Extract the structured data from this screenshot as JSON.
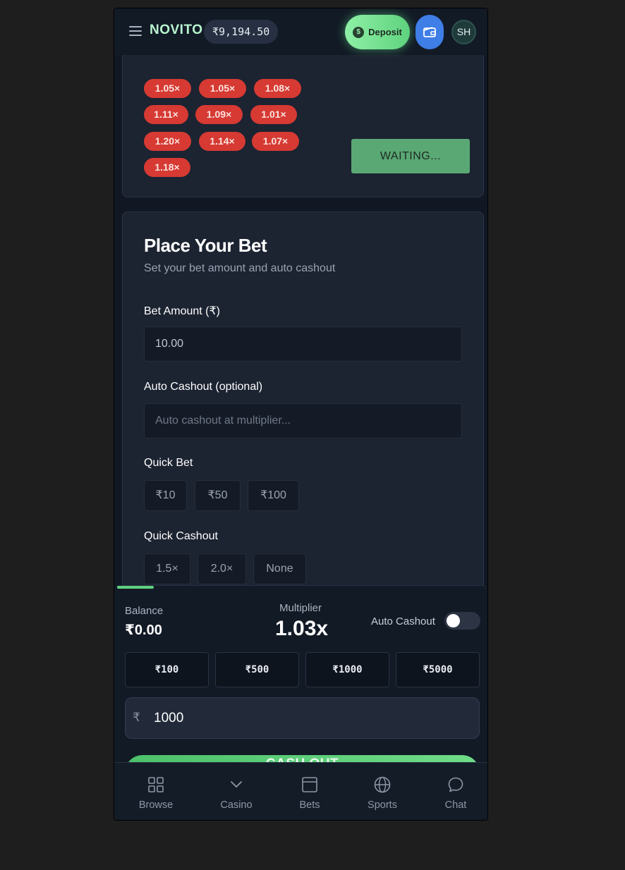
{
  "header": {
    "brand": "NOVITO",
    "balance": "₹9,194.50",
    "deposit_label": "Deposit",
    "deposit_icon": "$",
    "avatar_initials": "SH"
  },
  "history": {
    "multipliers": [
      "1.05×",
      "1.05×",
      "1.08×",
      "1.11×",
      "1.09×",
      "1.01×",
      "1.20×",
      "1.14×",
      "1.07×",
      "1.18×"
    ],
    "waiting_label": "WAITING..."
  },
  "bet_form": {
    "title": "Place Your Bet",
    "subtitle": "Set your bet amount and auto cashout",
    "bet_amount_label": "Bet Amount (₹)",
    "bet_amount_value": "10.00",
    "auto_cashout_label": "Auto Cashout (optional)",
    "auto_cashout_placeholder": "Auto cashout at multiplier...",
    "quick_bet_label": "Quick Bet",
    "quick_bets": [
      "₹10",
      "₹50",
      "₹100"
    ],
    "quick_cashout_label": "Quick Cashout",
    "quick_cashouts": [
      "1.5×",
      "2.0×",
      "None"
    ]
  },
  "panel": {
    "balance_label": "Balance",
    "balance_value": "₹0.00",
    "multiplier_label": "Multiplier",
    "multiplier_value": "1.03x",
    "auto_cashout_label": "Auto Cashout",
    "auto_cashout_on": false,
    "amounts": [
      "₹100",
      "₹500",
      "₹1000",
      "₹5000"
    ],
    "currency_symbol": "₹",
    "amount_value": "1000",
    "cashout_label": "CASH OUT"
  },
  "nav": {
    "items": [
      {
        "label": "Browse",
        "icon": "grid-icon"
      },
      {
        "label": "Casino",
        "icon": "chevron-down-icon"
      },
      {
        "label": "Bets",
        "icon": "card-icon"
      },
      {
        "label": "Sports",
        "icon": "globe-icon"
      },
      {
        "label": "Chat",
        "icon": "chat-icon"
      }
    ]
  },
  "colors": {
    "accent_green": "#5fd27e",
    "loss_red": "#d63a33",
    "wallet_blue": "#3e7ee6",
    "background": "#111824"
  }
}
